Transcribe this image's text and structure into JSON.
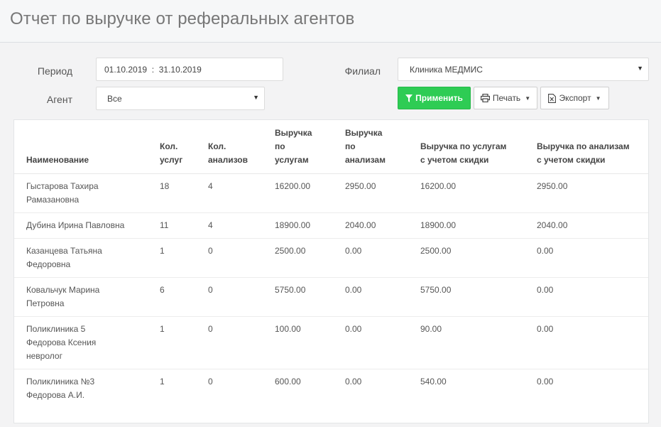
{
  "page": {
    "title": "Отчет по выручке от реферальных агентов"
  },
  "filters": {
    "period_label": "Период",
    "period_value": "01.10.2019  :  31.10.2019",
    "agent_label": "Агент",
    "agent_value": "Все",
    "branch_label": "Филиал",
    "branch_value": "Клиника МЕДМИС"
  },
  "toolbar": {
    "apply_label": "Применить",
    "print_label": "Печать",
    "export_label": "Экспорт"
  },
  "table": {
    "headers": [
      [
        "Наименование"
      ],
      [
        "Кол.",
        "услуг"
      ],
      [
        "Кол.",
        "анализов"
      ],
      [
        "Выручка",
        "по",
        "услугам"
      ],
      [
        "Выручка",
        "по",
        "анализам"
      ],
      [
        "Выручка по услугам",
        "с учетом скидки"
      ],
      [
        "Выручка по анализам",
        "с учетом скидки"
      ]
    ],
    "rows": [
      {
        "name": [
          "Гыстарова Тахира",
          "Рамазановна"
        ],
        "services": "18",
        "analyses": "4",
        "rev_services": "16200.00",
        "rev_analyses": "2950.00",
        "rev_services_disc": "16200.00",
        "rev_analyses_disc": "2950.00"
      },
      {
        "name": [
          "Дубина Ирина Павловна"
        ],
        "services": "11",
        "analyses": "4",
        "rev_services": "18900.00",
        "rev_analyses": "2040.00",
        "rev_services_disc": "18900.00",
        "rev_analyses_disc": "2040.00"
      },
      {
        "name": [
          "Казанцева Татьяна",
          "Федоровна"
        ],
        "services": "1",
        "analyses": "0",
        "rev_services": "2500.00",
        "rev_analyses": "0.00",
        "rev_services_disc": "2500.00",
        "rev_analyses_disc": "0.00"
      },
      {
        "name": [
          "Ковальчук Марина",
          "Петровна"
        ],
        "services": "6",
        "analyses": "0",
        "rev_services": "5750.00",
        "rev_analyses": "0.00",
        "rev_services_disc": "5750.00",
        "rev_analyses_disc": "0.00"
      },
      {
        "name": [
          "Поликлиника 5",
          "Федорова Ксения",
          "невролог"
        ],
        "services": "1",
        "analyses": "0",
        "rev_services": "100.00",
        "rev_analyses": "0.00",
        "rev_services_disc": "90.00",
        "rev_analyses_disc": "0.00"
      },
      {
        "name": [
          "Поликлиника №3",
          "Федорова А.И."
        ],
        "services": "1",
        "analyses": "0",
        "rev_services": "600.00",
        "rev_analyses": "0.00",
        "rev_services_disc": "540.00",
        "rev_analyses_disc": "0.00"
      }
    ]
  },
  "colors": {
    "primary": "#2ecc54",
    "background": "#f3f3f4"
  },
  "icons": {
    "apply": "filter-icon",
    "print": "printer-icon",
    "export": "excel-file-icon"
  }
}
